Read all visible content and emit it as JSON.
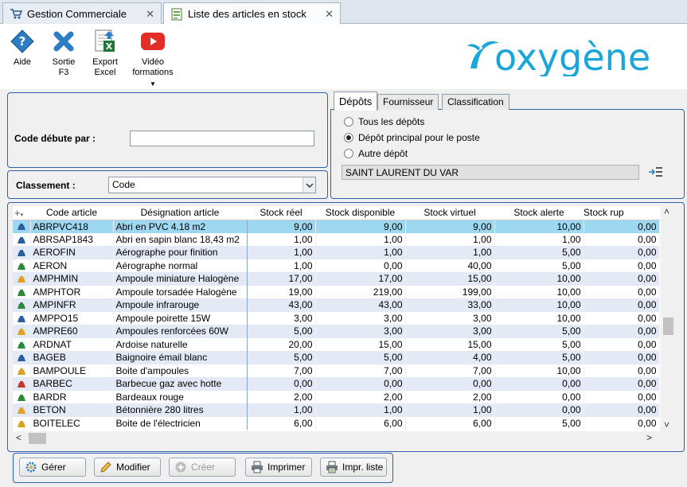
{
  "tabs": [
    {
      "label": "Gestion Commerciale",
      "active": false
    },
    {
      "label": "Liste des articles en stock",
      "active": true
    }
  ],
  "toolbar": {
    "aide": "Aide",
    "sortie_line1": "Sortie",
    "sortie_line2": "F3",
    "export_line1": "Export",
    "export_line2": "Excel",
    "video_line1": "Vidéo",
    "video_line2": "formations"
  },
  "logo": "oxygène",
  "filters": {
    "code_label": "Code débute par :",
    "code_value": "",
    "classement_label": "Classement :",
    "classement_value": "Code"
  },
  "subtabs": [
    "Dépôts",
    "Fournisseur",
    "Classification"
  ],
  "depots": {
    "options": [
      "Tous les dépôts",
      "Dépôt principal pour le poste",
      "Autre dépôt"
    ],
    "selected_index": 1,
    "current": "SAINT LAURENT DU VAR"
  },
  "grid": {
    "columns": [
      "Code article",
      "Désignation article",
      "Stock réel",
      "Stock disponible",
      "Stock virtuel",
      "Stock alerte",
      "Stock rup"
    ],
    "rows": [
      {
        "code": "ABRPVC418",
        "des": "Abri en PVC 4.18 m2",
        "reel": "9,00",
        "dispo": "9,00",
        "virt": "9,00",
        "alerte": "10,00",
        "rup": "0,00"
      },
      {
        "code": "ABRSAP1843",
        "des": "Abri en sapin blanc 18,43 m2",
        "reel": "1,00",
        "dispo": "1,00",
        "virt": "1,00",
        "alerte": "1,00",
        "rup": "0,00"
      },
      {
        "code": "AEROFIN",
        "des": "Aérographe pour finition",
        "reel": "1,00",
        "dispo": "1,00",
        "virt": "1,00",
        "alerte": "5,00",
        "rup": "0,00"
      },
      {
        "code": "AERON",
        "des": "Aérographe normal",
        "reel": "1,00",
        "dispo": "0,00",
        "virt": "40,00",
        "alerte": "5,00",
        "rup": "0,00"
      },
      {
        "code": "AMPHMIN",
        "des": "Ampoule miniature Halogène",
        "reel": "17,00",
        "dispo": "17,00",
        "virt": "15,00",
        "alerte": "10,00",
        "rup": "0,00"
      },
      {
        "code": "AMPHTOR",
        "des": "Ampoule torsadée Halogène",
        "reel": "19,00",
        "dispo": "219,00",
        "virt": "199,00",
        "alerte": "10,00",
        "rup": "0,00"
      },
      {
        "code": "AMPINFR",
        "des": "Ampoule infrarouge",
        "reel": "43,00",
        "dispo": "43,00",
        "virt": "33,00",
        "alerte": "10,00",
        "rup": "0,00"
      },
      {
        "code": "AMPPO15",
        "des": "Ampoule poirette 15W",
        "reel": "3,00",
        "dispo": "3,00",
        "virt": "3,00",
        "alerte": "10,00",
        "rup": "0,00"
      },
      {
        "code": "AMPRE60",
        "des": "Ampoules renforcées 60W",
        "reel": "5,00",
        "dispo": "3,00",
        "virt": "3,00",
        "alerte": "5,00",
        "rup": "0,00"
      },
      {
        "code": "ARDNAT",
        "des": "Ardoise naturelle",
        "reel": "20,00",
        "dispo": "15,00",
        "virt": "15,00",
        "alerte": "5,00",
        "rup": "0,00"
      },
      {
        "code": "BAGEB",
        "des": "Baignoire émail blanc",
        "reel": "5,00",
        "dispo": "5,00",
        "virt": "4,00",
        "alerte": "5,00",
        "rup": "0,00"
      },
      {
        "code": "BAMPOULE",
        "des": "Boite d'ampoules",
        "reel": "7,00",
        "dispo": "7,00",
        "virt": "7,00",
        "alerte": "10,00",
        "rup": "0,00"
      },
      {
        "code": "BARBEC",
        "des": "Barbecue gaz avec hotte",
        "reel": "0,00",
        "dispo": "0,00",
        "virt": "0,00",
        "alerte": "0,00",
        "rup": "0,00"
      },
      {
        "code": "BARDR",
        "des": "Bardeaux rouge",
        "reel": "2,00",
        "dispo": "2,00",
        "virt": "2,00",
        "alerte": "0,00",
        "rup": "0,00"
      },
      {
        "code": "BETON",
        "des": "Bétonnière 280 litres",
        "reel": "1,00",
        "dispo": "1,00",
        "virt": "1,00",
        "alerte": "0,00",
        "rup": "0,00"
      },
      {
        "code": "BOITELEC",
        "des": "Boite de l'électricien",
        "reel": "6,00",
        "dispo": "6,00",
        "virt": "6,00",
        "alerte": "5,00",
        "rup": "0,00"
      }
    ]
  },
  "buttons": {
    "gerer": "Gérer",
    "modifier": "Modifier",
    "creer": "Créer",
    "imprimer": "Imprimer",
    "impr_liste": "Impr. liste"
  },
  "colors": {
    "panel_border": "#2f5fa8",
    "selected_row": "#9ed8f0",
    "alt_row": "#e3e9f5",
    "logo_blue": "#1aa6d9"
  }
}
